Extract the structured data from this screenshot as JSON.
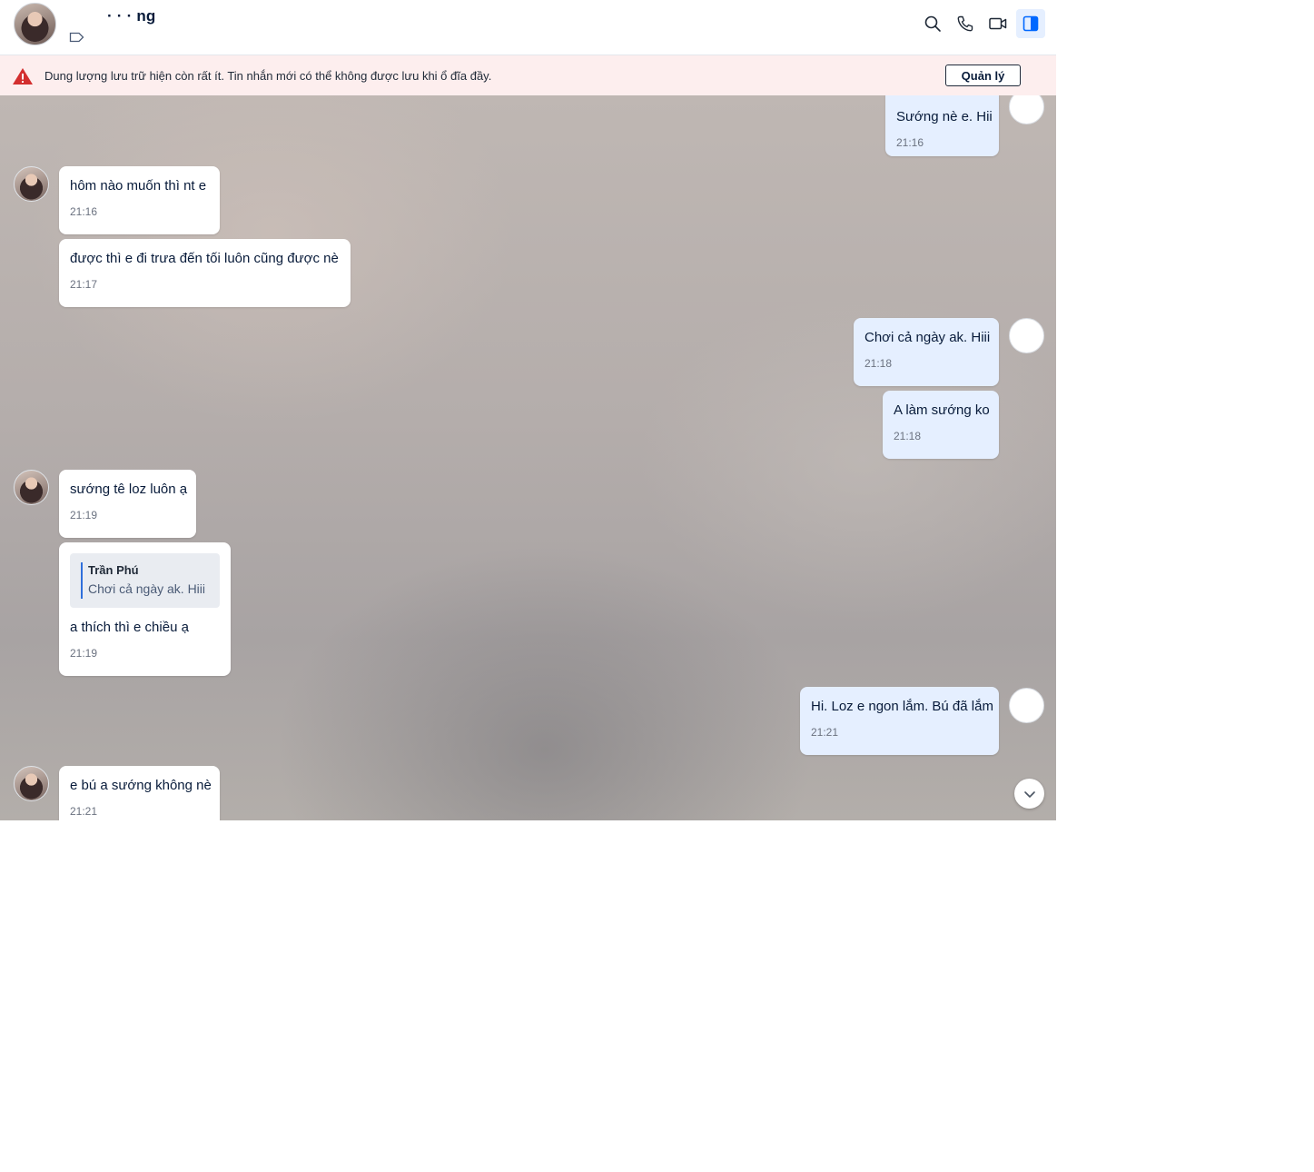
{
  "header": {
    "contact_name": "· · ·  ng",
    "icons": [
      "search-icon",
      "phone-icon",
      "video-icon",
      "panel-toggle-icon"
    ]
  },
  "banner": {
    "text": "Dung lượng lưu trữ hiện còn rất ít. Tin nhắn mới có thể không được lưu khi ổ đĩa đầy.",
    "button_label": "Quản lý",
    "color": "#d32f2f"
  },
  "messages": [
    {
      "side": "mine",
      "text": "Sướng nè e. Hii",
      "time": "21:16"
    },
    {
      "side": "theirs",
      "text": "hôm nào muốn thì nt e",
      "time": "21:16"
    },
    {
      "side": "theirs",
      "text": "được thì e đi trưa đến tối luôn cũng được nè",
      "time": "21:17"
    },
    {
      "side": "mine",
      "text": "Chơi cả ngày ak. Hiii",
      "time": "21:18"
    },
    {
      "side": "mine",
      "text": "A làm sướng ko",
      "time": "21:18"
    },
    {
      "side": "theirs",
      "text": "sướng tê loz luôn ạ",
      "time": "21:19"
    },
    {
      "side": "theirs",
      "quote": {
        "author": "Trần Phú",
        "text": "Chơi cả ngày ak. Hiii"
      },
      "text": "a thích thì e chiều ạ",
      "time": "21:19"
    },
    {
      "side": "mine",
      "text": "Hi. Loz e ngon lắm. Bú đã lắm",
      "time": "21:21"
    },
    {
      "side": "theirs",
      "text": "e bú a sướng không nè",
      "time": "21:21"
    }
  ],
  "colors": {
    "accent": "#0068ff",
    "my_bubble": "#e5efff",
    "their_bubble": "#ffffff",
    "banner_bg": "#fdeeee"
  }
}
